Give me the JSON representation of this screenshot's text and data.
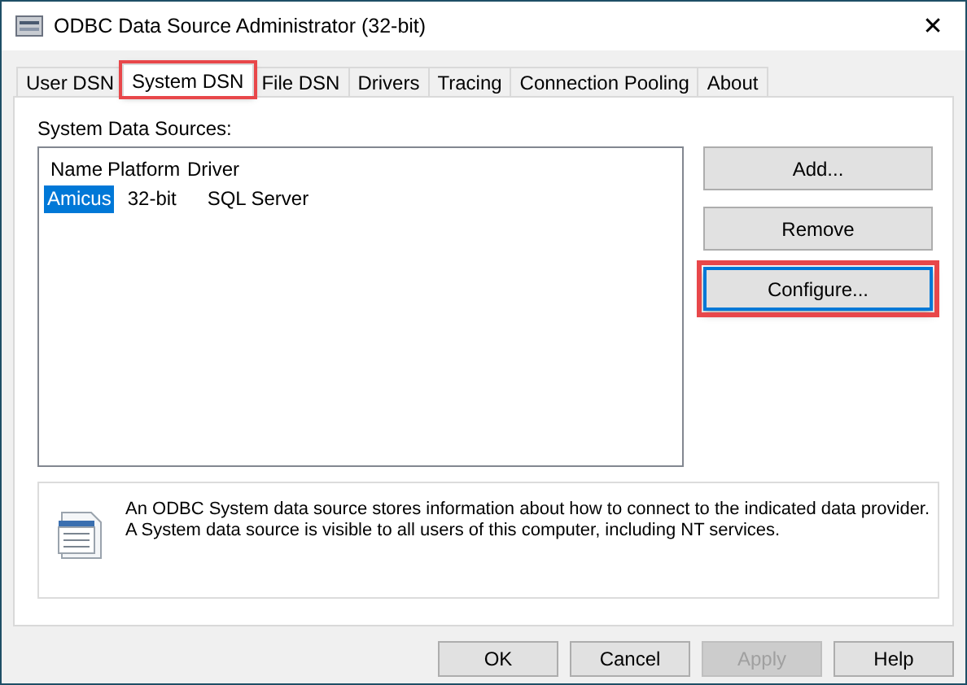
{
  "window": {
    "title": "ODBC Data Source Administrator (32-bit)",
    "close": "✕"
  },
  "tabs": [
    {
      "label": "User DSN",
      "selected": false,
      "highlighted": false
    },
    {
      "label": "System DSN",
      "selected": true,
      "highlighted": true
    },
    {
      "label": "File DSN",
      "selected": false,
      "highlighted": false
    },
    {
      "label": "Drivers",
      "selected": false,
      "highlighted": false
    },
    {
      "label": "Tracing",
      "selected": false,
      "highlighted": false
    },
    {
      "label": "Connection Pooling",
      "selected": false,
      "highlighted": false
    },
    {
      "label": "About",
      "selected": false,
      "highlighted": false
    }
  ],
  "sources": {
    "label": "System Data Sources:",
    "columns": [
      "Name",
      "Platform",
      "Driver"
    ],
    "rows": [
      {
        "cells": [
          "Amicus",
          "32-bit",
          "SQL Server"
        ],
        "selected": true
      }
    ]
  },
  "side_buttons": [
    {
      "label": "Add...",
      "highlighted": false,
      "focused": false
    },
    {
      "label": "Remove",
      "highlighted": false,
      "focused": false
    },
    {
      "label": "Configure...",
      "highlighted": true,
      "focused": true
    }
  ],
  "info": "An ODBC System data source stores information about how to connect to the indicated data provider.\nA System data source is visible to all users of this computer, including NT services.",
  "buttons": [
    {
      "label": "OK",
      "disabled": false
    },
    {
      "label": "Cancel",
      "disabled": false
    },
    {
      "label": "Apply",
      "disabled": true
    },
    {
      "label": "Help",
      "disabled": false
    }
  ]
}
